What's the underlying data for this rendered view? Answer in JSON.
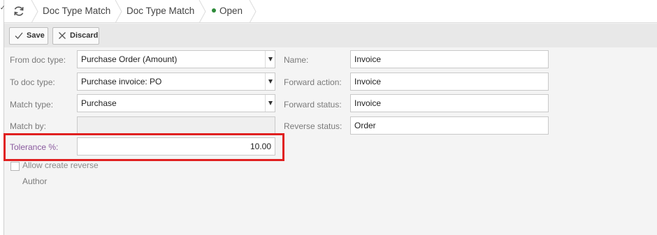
{
  "breadcrumb": {
    "items": [
      "Doc Type Match",
      "Doc Type Match"
    ],
    "status": "Open"
  },
  "toolbar": {
    "save_label": "Save",
    "discard_label": "Discard"
  },
  "form": {
    "from_doc_type": {
      "label": "From doc type:",
      "value": "Purchase Order (Amount)"
    },
    "to_doc_type": {
      "label": "To doc type:",
      "value": "Purchase invoice: PO"
    },
    "match_type": {
      "label": "Match type:",
      "value": "Purchase"
    },
    "match_by": {
      "label": "Match by:",
      "value": ""
    },
    "tolerance": {
      "label": "Tolerance %:",
      "value": "10.00"
    },
    "allow_create_reverse": {
      "label": "Allow create reverse",
      "checked": false
    },
    "author": {
      "label": "Author"
    },
    "name": {
      "label": "Name:",
      "value": "Invoice"
    },
    "forward_action": {
      "label": "Forward action:",
      "value": "Invoice"
    },
    "forward_status": {
      "label": "Forward status:",
      "value": "Invoice"
    },
    "reverse_status": {
      "label": "Reverse status:",
      "value": "Order"
    }
  },
  "colors": {
    "status_dot": "#2e8b3a",
    "highlight": "#e02020",
    "tolerance_label": "#8a5a9e"
  }
}
